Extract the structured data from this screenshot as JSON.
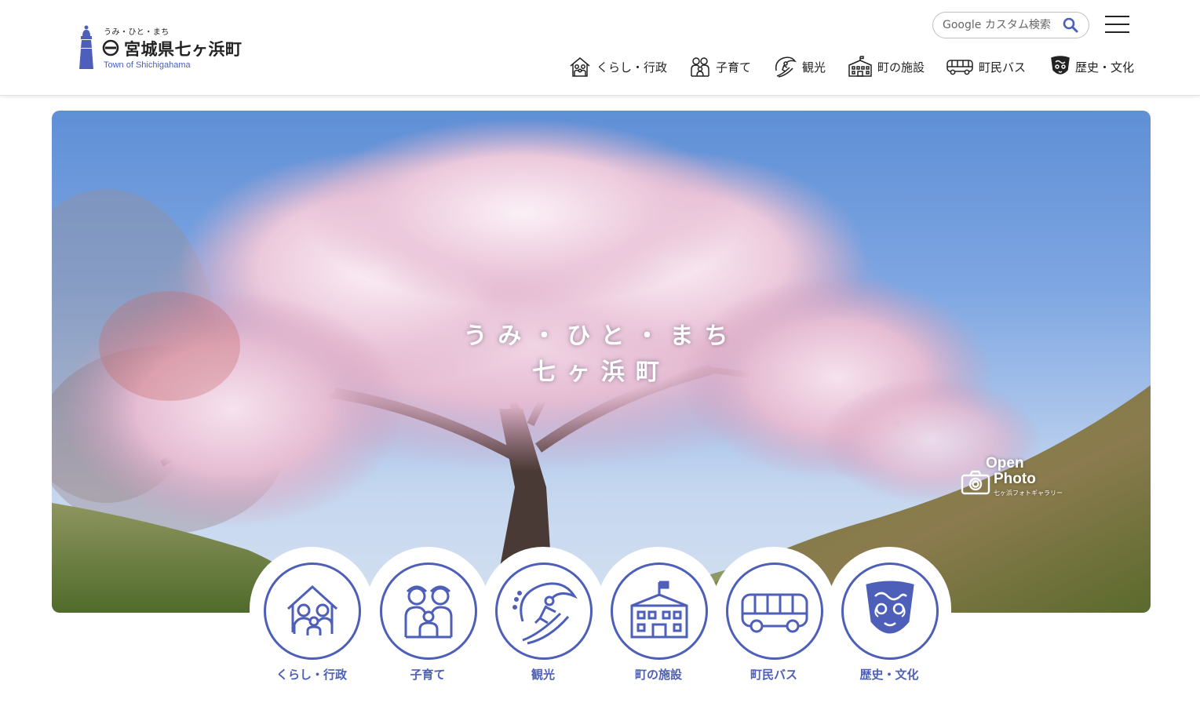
{
  "header": {
    "logo": {
      "tagline": "うみ・ひと・まち",
      "name": "宮城県七ヶ浜町",
      "name_en": "Town of Shichigahama"
    },
    "search": {
      "placeholder": "Google カスタム検索",
      "button_icon": "search-icon"
    },
    "menu_icon": "hamburger-menu-icon",
    "nav": [
      {
        "label": "くらし・行政",
        "icon": "house-family-icon"
      },
      {
        "label": "子育て",
        "icon": "parent-child-icon"
      },
      {
        "label": "観光",
        "icon": "surfer-icon"
      },
      {
        "label": "町の施設",
        "icon": "building-icon"
      },
      {
        "label": "町民バス",
        "icon": "bus-icon"
      },
      {
        "label": "歴史・文化",
        "icon": "crest-icon"
      }
    ]
  },
  "hero": {
    "title_line1": "うみ・ひと・まち",
    "title_line2": "七ヶ浜町",
    "open_photo": {
      "line1": "Open",
      "line2": "Photo",
      "sub": "七ヶ浜フォトギャラリー",
      "icon": "camera-icon"
    }
  },
  "categories": [
    {
      "label": "くらし・行政",
      "icon": "house-family-icon"
    },
    {
      "label": "子育て",
      "icon": "parent-child-icon"
    },
    {
      "label": "観光",
      "icon": "surfer-icon"
    },
    {
      "label": "町の施設",
      "icon": "building-icon"
    },
    {
      "label": "町民バス",
      "icon": "bus-icon"
    },
    {
      "label": "歴史・文化",
      "icon": "crest-icon"
    }
  ],
  "colors": {
    "accent": "#4d5fb8",
    "header_bg": "#ffffff",
    "text": "#222222"
  }
}
